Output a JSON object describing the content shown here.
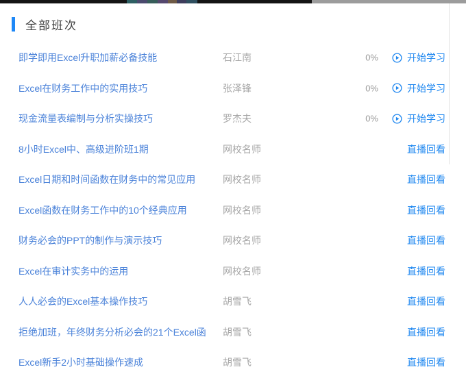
{
  "header": {
    "title": "全部班次"
  },
  "rows": [
    {
      "title": "即学即用Excel升职加薪必备技能",
      "instructor": "石江南",
      "progress": "0%",
      "action": "开始学习",
      "action_type": "play"
    },
    {
      "title": "Excel在财务工作中的实用技巧",
      "instructor": "张泽锋",
      "progress": "0%",
      "action": "开始学习",
      "action_type": "play"
    },
    {
      "title": "现金流量表编制与分析实操技巧",
      "instructor": "罗杰夫",
      "progress": "0%",
      "action": "开始学习",
      "action_type": "play"
    },
    {
      "title": "8小时Excel中、高级进阶班1期",
      "instructor": "网校名师",
      "progress": "",
      "action": "直播回看",
      "action_type": "replay"
    },
    {
      "title": "Excel日期和时间函数在财务中的常见应用",
      "instructor": "网校名师",
      "progress": "",
      "action": "直播回看",
      "action_type": "replay"
    },
    {
      "title": "Excel函数在财务工作中的10个经典应用",
      "instructor": "网校名师",
      "progress": "",
      "action": "直播回看",
      "action_type": "replay"
    },
    {
      "title": "财务必会的PPT的制作与演示技巧",
      "instructor": "网校名师",
      "progress": "",
      "action": "直播回看",
      "action_type": "replay"
    },
    {
      "title": "Excel在审计实务中的运用",
      "instructor": "网校名师",
      "progress": "",
      "action": "直播回看",
      "action_type": "replay"
    },
    {
      "title": "人人必会的Excel基本操作技巧",
      "instructor": "胡雪飞",
      "progress": "",
      "action": "直播回看",
      "action_type": "replay"
    },
    {
      "title": "拒绝加班，年终财务分析必会的21个Excel函",
      "instructor": "胡雪飞",
      "progress": "",
      "action": "直播回看",
      "action_type": "replay"
    },
    {
      "title": "Excel新手2小时基础操作速成",
      "instructor": "胡雪飞",
      "progress": "",
      "action": "直播回看",
      "action_type": "replay"
    }
  ],
  "colors": {
    "accent_blue": "#1E88F7",
    "course_title_blue": "#4A82D9",
    "action_link_blue": "#2088F0",
    "instructor_gray": "#A6A6A6",
    "percent_gray": "#9B9B9B"
  }
}
